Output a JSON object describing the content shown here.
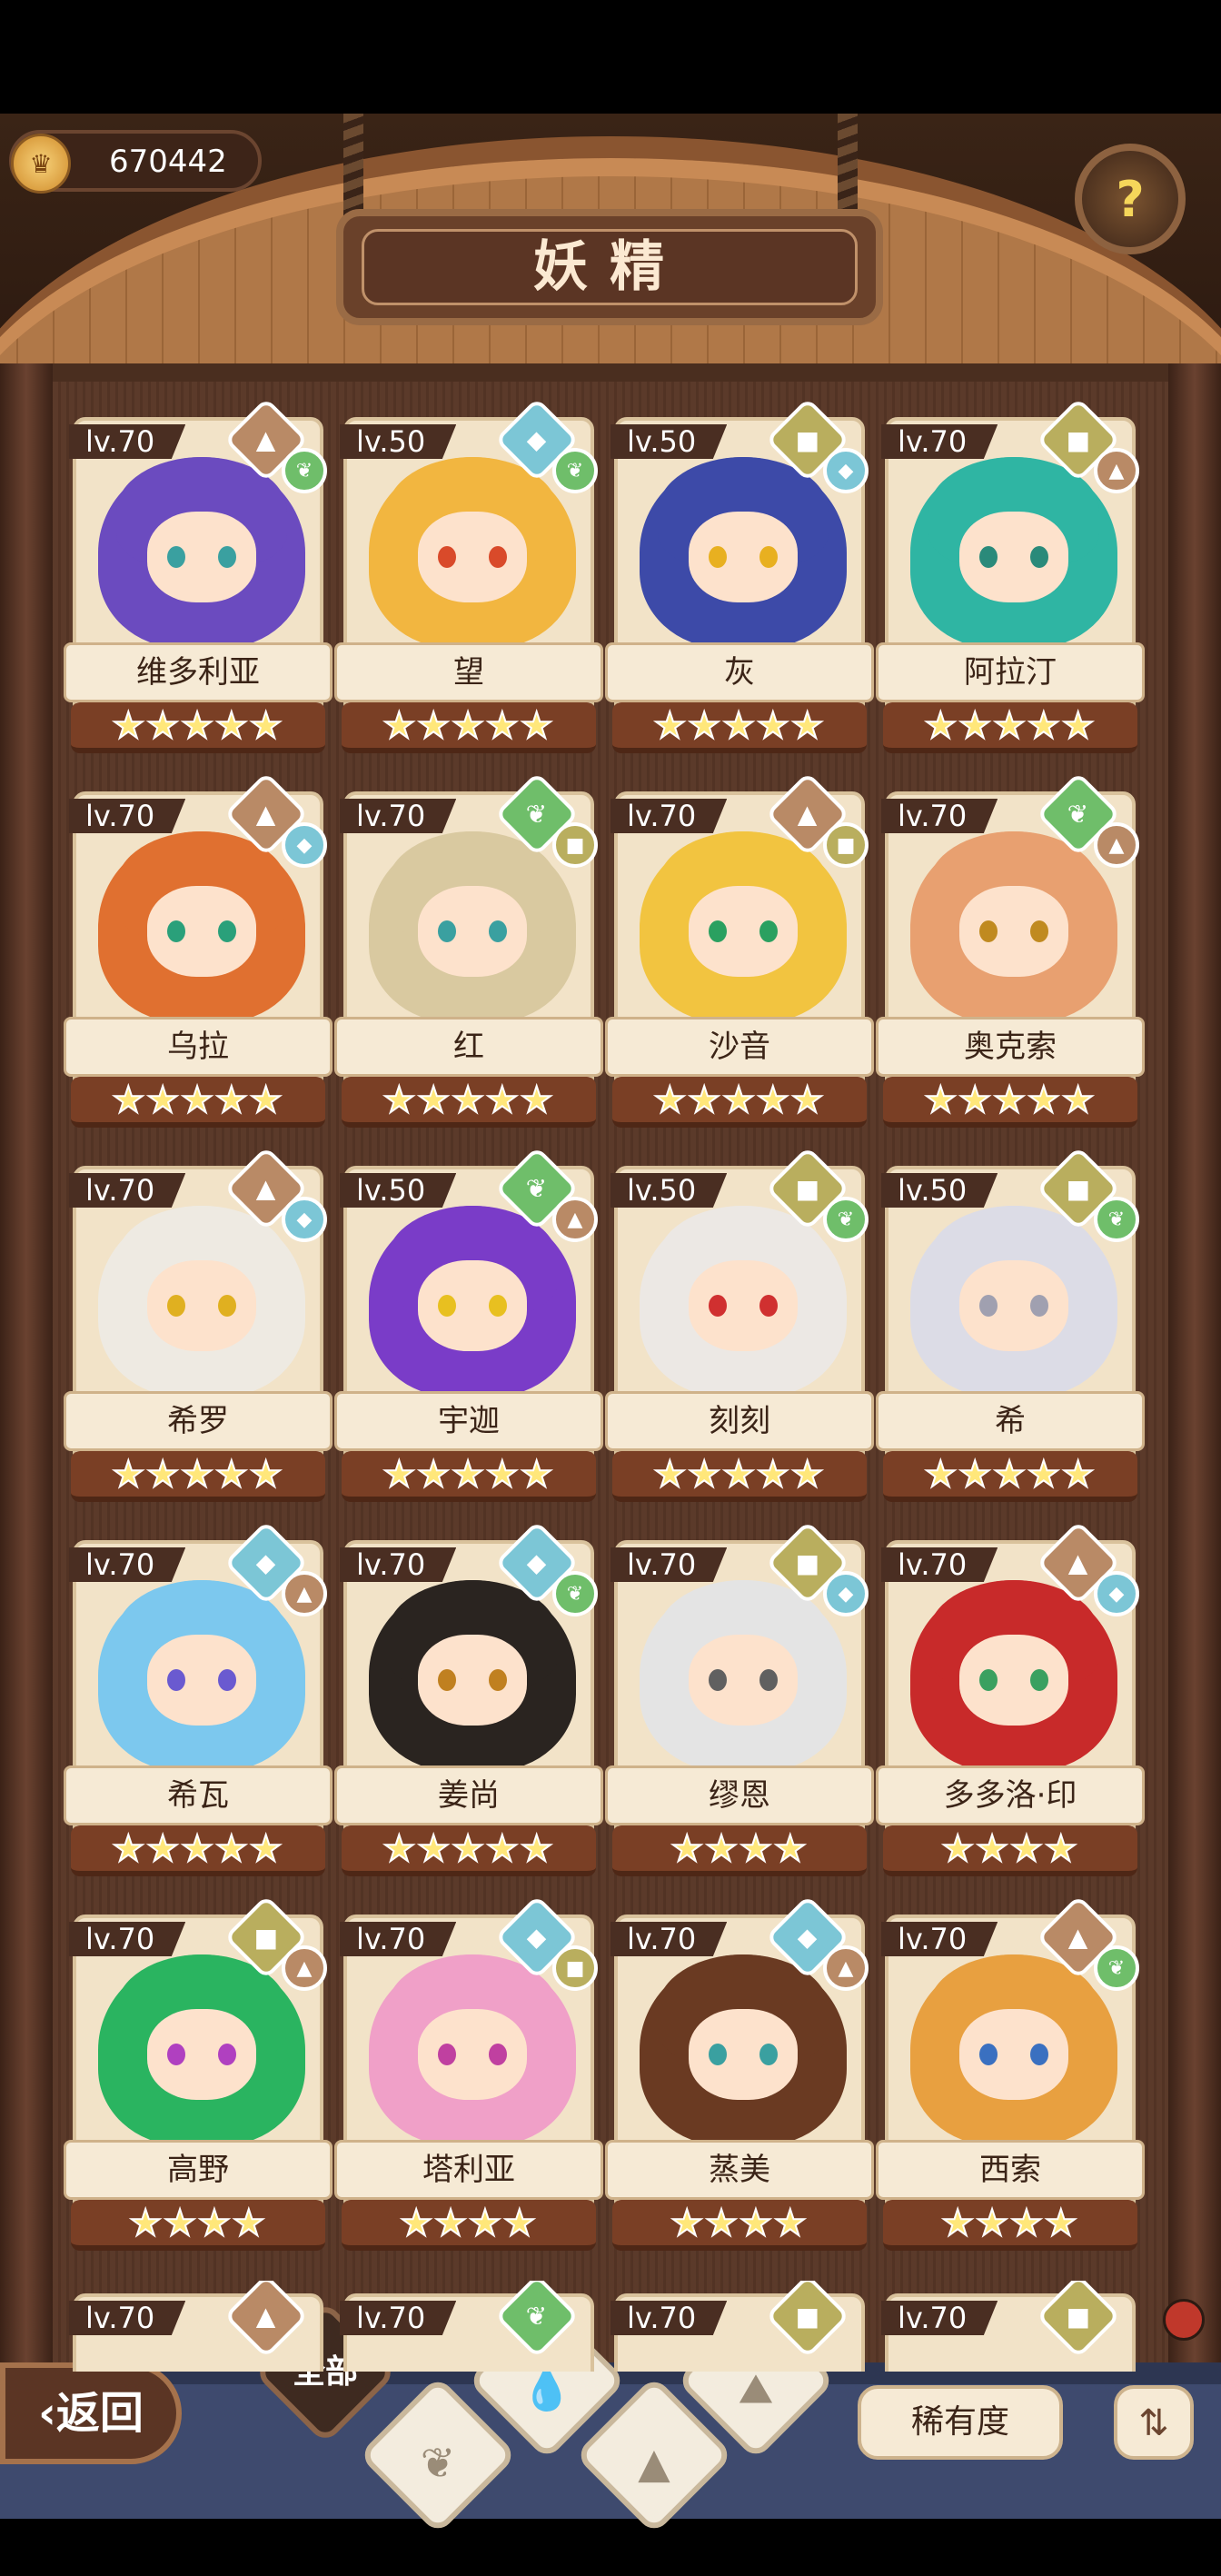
{
  "currency": {
    "icon": "coin-icon",
    "value": "670442"
  },
  "title": "妖精",
  "help_icon": "?",
  "cards": [
    {
      "level": "lv.70",
      "name": "维多利亚",
      "stars": "★★★★★",
      "element1": "fire",
      "element2": "leaf",
      "hair": "#6b4bbf",
      "eye": "#3aa0a0"
    },
    {
      "level": "lv.50",
      "name": "望",
      "stars": "★★★★★",
      "element1": "water",
      "element2": "leaf",
      "hair": "#f2b640",
      "eye": "#d94a2a"
    },
    {
      "level": "lv.50",
      "name": "灰",
      "stars": "★★★★★",
      "element1": "earth",
      "element2": "water",
      "hair": "#3d4aa8",
      "eye": "#e8b020"
    },
    {
      "level": "lv.70",
      "name": "阿拉汀",
      "stars": "★★★★★",
      "element1": "earth",
      "element2": "fire",
      "hair": "#2fb5a3",
      "eye": "#2a8a7a"
    },
    {
      "level": "lv.70",
      "name": "乌拉",
      "stars": "★★★★★",
      "element1": "fire",
      "element2": "water",
      "hair": "#e07030",
      "eye": "#2aa07a"
    },
    {
      "level": "lv.70",
      "name": "红",
      "stars": "★★★★★",
      "element1": "leaf",
      "element2": "earth",
      "hair": "#d9c9a0",
      "eye": "#3aa0a0"
    },
    {
      "level": "lv.70",
      "name": "沙音",
      "stars": "★★★★★",
      "element1": "fire",
      "element2": "earth",
      "hair": "#f2c440",
      "eye": "#2aa060"
    },
    {
      "level": "lv.70",
      "name": "奥克索",
      "stars": "★★★★★",
      "element1": "leaf",
      "element2": "fire",
      "hair": "#e8a070",
      "eye": "#c08a20"
    },
    {
      "level": "lv.70",
      "name": "希罗",
      "stars": "★★★★★",
      "element1": "fire",
      "element2": "water",
      "hair": "#eeeae2",
      "eye": "#e0b020"
    },
    {
      "level": "lv.50",
      "name": "宇迦",
      "stars": "★★★★★",
      "element1": "leaf",
      "element2": "fire",
      "hair": "#7a3cc8",
      "eye": "#e8c020"
    },
    {
      "level": "lv.50",
      "name": "刻刻",
      "stars": "★★★★★",
      "element1": "earth",
      "element2": "leaf",
      "hair": "#ece8e4",
      "eye": "#d03030"
    },
    {
      "level": "lv.50",
      "name": "希",
      "stars": "★★★★★",
      "element1": "earth",
      "element2": "leaf",
      "hair": "#dcdce6",
      "eye": "#a0a0b0"
    },
    {
      "level": "lv.70",
      "name": "希瓦",
      "stars": "★★★★★",
      "element1": "water",
      "element2": "fire",
      "hair": "#7cc8ee",
      "eye": "#6a5ad0"
    },
    {
      "level": "lv.70",
      "name": "姜尚",
      "stars": "★★★★★",
      "element1": "water",
      "element2": "leaf",
      "hair": "#2a2420",
      "eye": "#c08020"
    },
    {
      "level": "lv.70",
      "name": "缪恩",
      "stars": "★★★★",
      "element1": "earth",
      "element2": "water",
      "hair": "#e4e4e4",
      "eye": "#606060"
    },
    {
      "level": "lv.70",
      "name": "多多洛·印",
      "stars": "★★★★",
      "element1": "fire",
      "element2": "water",
      "hair": "#c82a2a",
      "eye": "#3aa060"
    },
    {
      "level": "lv.70",
      "name": "高野",
      "stars": "★★★★",
      "element1": "earth",
      "element2": "fire",
      "hair": "#2ab460",
      "eye": "#b040c0"
    },
    {
      "level": "lv.70",
      "name": "塔利亚",
      "stars": "★★★★",
      "element1": "water",
      "element2": "earth",
      "hair": "#f0a0c8",
      "eye": "#c040a0"
    },
    {
      "level": "lv.70",
      "name": "蒸美",
      "stars": "★★★★",
      "element1": "water",
      "element2": "fire",
      "hair": "#6a3a22",
      "eye": "#3aa0a0"
    },
    {
      "level": "lv.70",
      "name": "西索",
      "stars": "★★★★",
      "element1": "fire",
      "element2": "leaf",
      "hair": "#e8a040",
      "eye": "#3a70c0"
    }
  ],
  "partial_row": [
    {
      "level": "lv.70",
      "element1": "fire"
    },
    {
      "level": "lv.70",
      "element1": "leaf"
    },
    {
      "level": "lv.70",
      "element1": "earth"
    },
    {
      "level": "lv.70",
      "element1": "earth"
    }
  ],
  "bottom": {
    "back_label": "返回",
    "back_icon": "chevron-left-icon",
    "filter_all_label": "全部",
    "filters": [
      "water-drop-icon",
      "sprout-icon",
      "mountain-icon",
      "volcano-icon"
    ],
    "sort_label": "稀有度",
    "order_icon": "sort-order-icon"
  },
  "colors": {
    "wood_dark": "#4a2e1f",
    "paper": "#f2e3c8",
    "star": "#ffe77a",
    "bottom_bar": "#3e4a6e"
  }
}
